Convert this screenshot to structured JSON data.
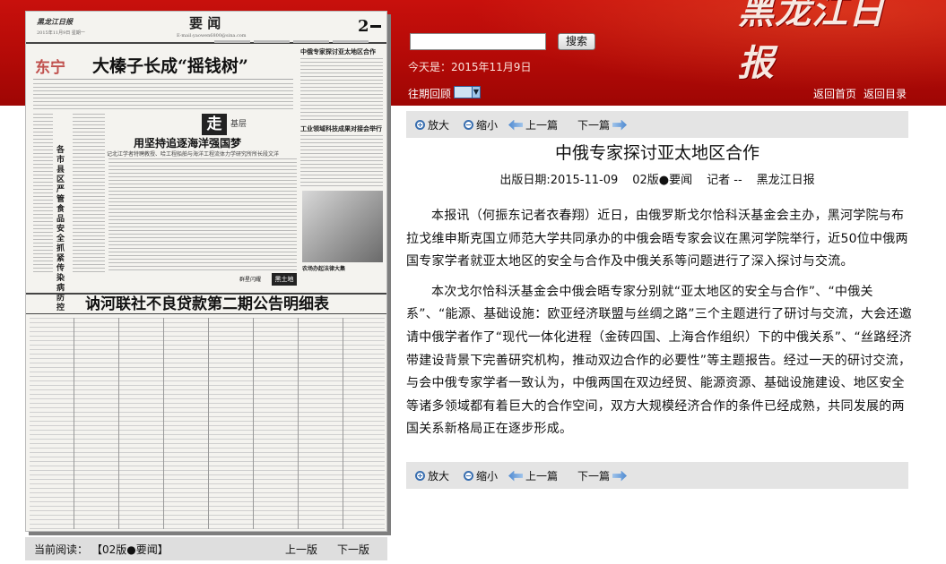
{
  "masthead": {
    "logo_text": "黑龙江日报"
  },
  "search": {
    "input_value": "",
    "button_label": "搜索"
  },
  "today": {
    "text": "今天是：2015年11月9日"
  },
  "archive": {
    "label": "往期回顾"
  },
  "top_links": {
    "home": "返回首页",
    "index": "返回目录"
  },
  "newspaper_page": {
    "logo": "黑龙江日报",
    "date": "2015年11月9日 星期一",
    "section": "要 闻",
    "email": "E-mail:yaowen6800@sina.com",
    "page_number": "2",
    "lead_place": "东宁",
    "lead_title": "大榛子长成“摇钱树”",
    "side_title": "中俄专家探讨亚太地区合作",
    "vertical_title": "各市县区严管食品安全抓紧传染病防控",
    "zou_char": "走",
    "zou_word": "基层",
    "mid_title": "用坚持追逐海洋强国梦",
    "mid_sub": "记北江学者特聘教授、哈工程船舶与海洋工程流体力学研究所所长段文洋",
    "right_title2": "工业领域科技成果对接会举行",
    "photo_caption": "农场办起法律大集",
    "tag_left": "群星闪耀",
    "tag_right": "黑土地",
    "table_title": "讷河联社不良贷款第二期公告明细表"
  },
  "pager": {
    "current_label": "当前阅读：",
    "current_value": "【02版●要闻】",
    "prev_edition": "上一版",
    "next_edition": "下一版"
  },
  "toolbar": {
    "zoom_in": "放大",
    "zoom_out": "缩小",
    "prev_article": "上一篇",
    "next_article": "下一篇"
  },
  "article": {
    "title": "中俄专家探讨亚太地区合作",
    "date": "出版日期:2015-11-09",
    "edition": "02版●要闻",
    "reporter": "记者 --",
    "source": "黑龙江日报",
    "paragraphs": [
      "本报讯（何振东记者衣春翔）近日，由俄罗斯戈尔恰科沃基金会主办，黑河学院与布拉戈维申斯克国立师范大学共同承办的中俄会晤专家会议在黑河学院举行，近50位中俄两国专家学者就亚太地区的安全与合作及中俄关系等问题进行了深入探讨与交流。",
      "本次戈尔恰科沃基金会中俄会晤专家分别就“亚太地区的安全与合作”、“中俄关系”、“能源、基础设施：欧亚经济联盟与丝绸之路”三个主题进行了研讨与交流，大会还邀请中俄学者作了“现代一体化进程（金砖四国、上海合作组织）下的中俄关系”、“丝路经济带建设背景下完善研究机构，推动双边合作的必要性”等主题报告。经过一天的研讨交流，与会中俄专家学者一致认为，中俄两国在双边经贸、能源资源、基础设施建设、地区安全等诸多领域都有着巨大的合作空间，双方大规模经济合作的条件已经成熟，共同发展的两国关系新格局正在逐步形成。"
    ]
  }
}
